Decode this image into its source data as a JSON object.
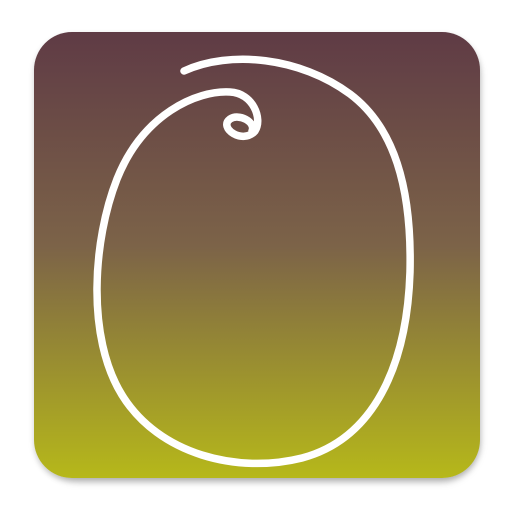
{
  "app_icon": {
    "name": "olive-logo",
    "colors": {
      "gradient_top": "#5f3b45",
      "gradient_mid": "#7c6348",
      "gradient_bottom": "#b6b81a",
      "stroke": "#ffffff"
    }
  }
}
